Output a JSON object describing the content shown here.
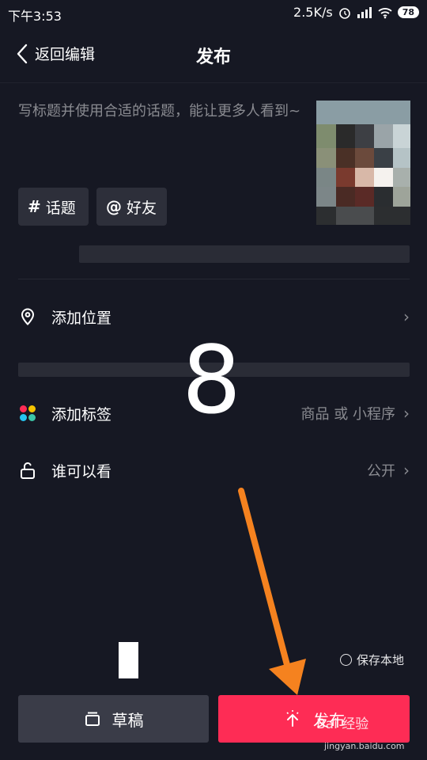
{
  "status_bar": {
    "time": "下午3:53",
    "speed": "2.5K/s",
    "battery": "78"
  },
  "header": {
    "back_label": "返回编辑",
    "title": "发布"
  },
  "description": {
    "placeholder": "写标题并使用合适的话题，能让更多人看到~"
  },
  "chips": {
    "topic": "话题",
    "friends": "好友"
  },
  "rows": {
    "location": {
      "label": "添加位置"
    },
    "tag": {
      "label": "添加标签",
      "value": "商品 或 小程序"
    },
    "visibility": {
      "label": "谁可以看",
      "value": "公开"
    }
  },
  "overlay_number": "8",
  "save_local": "保存本地",
  "buttons": {
    "draft": "草稿",
    "publish": "发布"
  },
  "watermark": {
    "brand": "Bai 经验",
    "url": "jingyan.baidu.com"
  },
  "colors": {
    "background": "#161823",
    "accent": "#fe2c55",
    "arrow": "#f5821f"
  }
}
